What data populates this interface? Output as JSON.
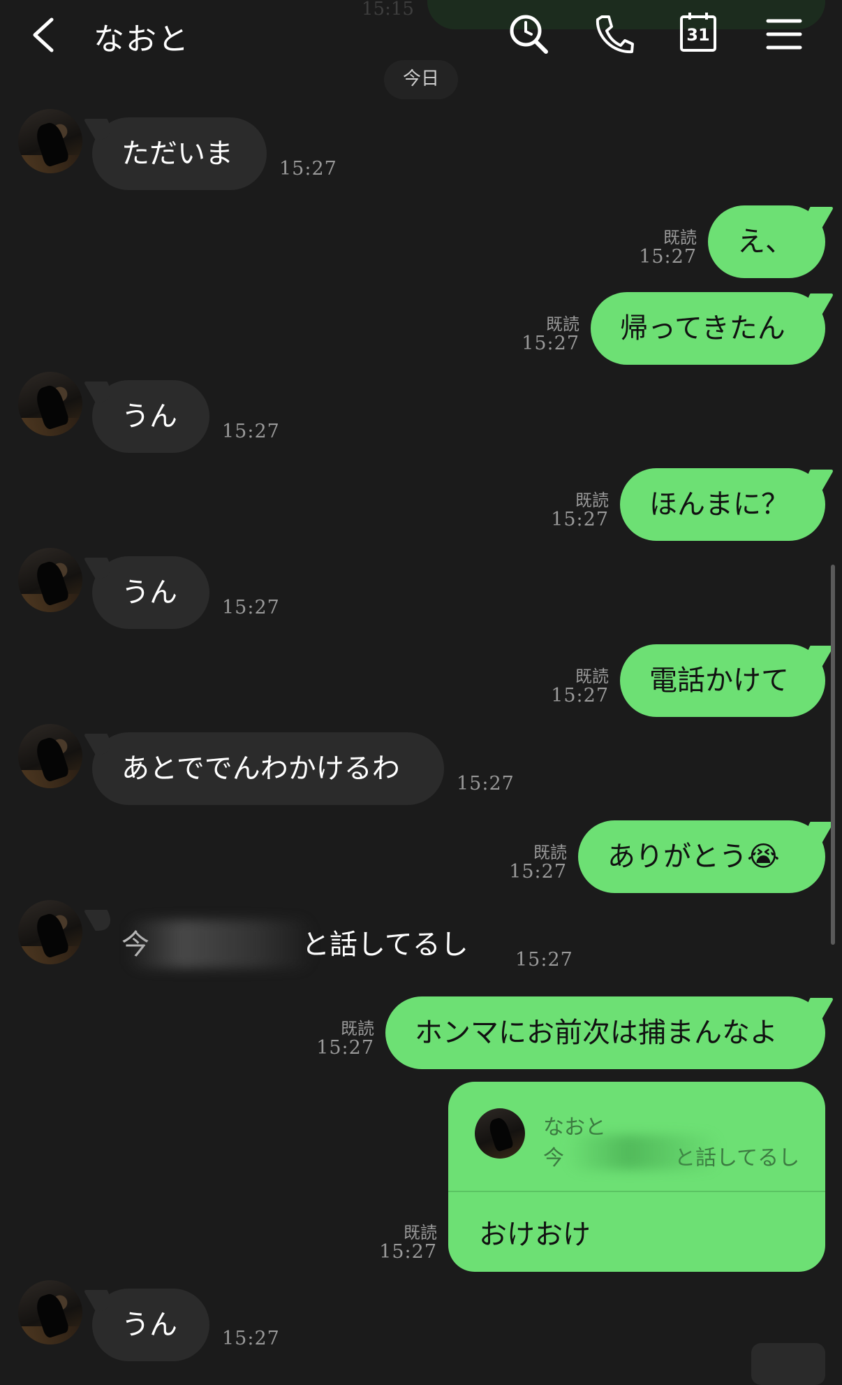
{
  "header": {
    "title": "なおと",
    "ghost_time": "15:15",
    "date_divider": "今日",
    "calendar_day": "31",
    "icons": [
      "back-icon",
      "search-icon",
      "phone-icon",
      "calendar-icon",
      "menu-icon"
    ]
  },
  "colors": {
    "background": "#1b1b1b",
    "incoming_bubble": "#2b2b2b",
    "outgoing_bubble": "#6de074",
    "meta_text": "#9a9a9a"
  },
  "messages": [
    {
      "side": "in",
      "text": "ただいま",
      "time": "15:27"
    },
    {
      "side": "out",
      "text": "え、",
      "read": "既読",
      "time": "15:27"
    },
    {
      "side": "out",
      "text": "帰ってきたん",
      "read": "既読",
      "time": "15:27"
    },
    {
      "side": "in",
      "text": "うん",
      "time": "15:27"
    },
    {
      "side": "out",
      "text": "ほんまに？",
      "read": "既読",
      "time": "15:27"
    },
    {
      "side": "in",
      "text": "うん",
      "time": "15:27"
    },
    {
      "side": "out",
      "text": "電話かけて",
      "read": "既読",
      "time": "15:27"
    },
    {
      "side": "in",
      "text": "あとででんわかけるわ",
      "time": "15:27"
    },
    {
      "side": "out",
      "text": "ありがとう😭",
      "read": "既読",
      "time": "15:27"
    },
    {
      "side": "in",
      "text_start": "今",
      "text_end": "と話してるし",
      "redacted": true,
      "time": "15:27"
    },
    {
      "side": "out",
      "text": "ホンマにお前次は捕まんなよ",
      "read": "既読",
      "time": "15:27"
    },
    {
      "side": "out",
      "reply_to_name": "なおと",
      "reply_to_start": "今",
      "reply_to_end": "と話してるし",
      "text": "おけおけ",
      "read": "既読",
      "time": "15:27"
    },
    {
      "side": "in",
      "text": "うん",
      "time": "15:27"
    }
  ]
}
